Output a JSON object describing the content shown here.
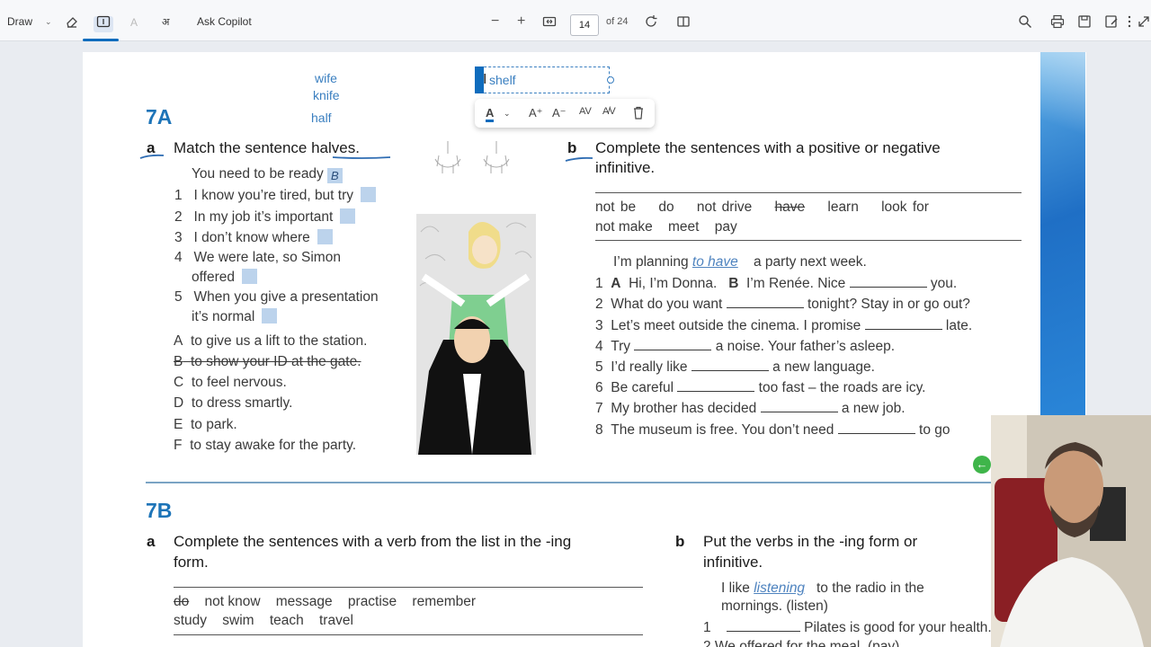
{
  "toolbar": {
    "draw_label": "Draw",
    "ask_copilot_label": "Ask Copilot",
    "page_current": "14",
    "page_total": "of 24",
    "zoom_out": "−",
    "zoom_in": "+"
  },
  "annotation": {
    "text": "shelf",
    "handwritten_words": [
      "wife",
      "knife",
      "half"
    ]
  },
  "section_7a": {
    "title": "7A",
    "a_label": "a",
    "a_instruction": "Match the sentence halves.",
    "example_line": "You need to be ready",
    "example_box": "B",
    "items": [
      {
        "num": "1",
        "text": "I know you’re tired, but try"
      },
      {
        "num": "2",
        "text": "In my job it’s important"
      },
      {
        "num": "3",
        "text": "I don’t know where"
      },
      {
        "num": "4",
        "text": "We were late, so Simon"
      },
      {
        "num": "",
        "text": "offered"
      },
      {
        "num": "5",
        "text": "When you give a presentation"
      },
      {
        "num": "",
        "text": "it’s normal"
      }
    ],
    "options": [
      {
        "letter": "A",
        "text": "to give us a lift to the station."
      },
      {
        "letter": "B",
        "text": "to show your ID at the gate."
      },
      {
        "letter": "C",
        "text": "to feel nervous."
      },
      {
        "letter": "D",
        "text": "to dress smartly."
      },
      {
        "letter": "E",
        "text": "to park."
      },
      {
        "letter": "F",
        "text": "to stay awake for the party."
      }
    ],
    "b_label": "b",
    "b_instruction_line1": "Complete the sentences with a positive or negative",
    "b_instruction_line2": "infinitive.",
    "word_bank_row1": [
      "not be",
      "do",
      "not drive",
      "have",
      "learn",
      "look for"
    ],
    "word_bank_row2": [
      "not make",
      "meet",
      "pay"
    ],
    "example_pre": "I’m planning",
    "example_answer": "to have",
    "example_post": "a party next week.",
    "sentences": [
      {
        "num": "1",
        "pre": "A  Hi, I’m Donna.   B  I’m Renée. Nice",
        "post": "you."
      },
      {
        "num": "2",
        "pre": "What do you want",
        "post": "tonight? Stay in or go out?"
      },
      {
        "num": "3",
        "pre": "Let’s meet outside the cinema. I promise",
        "post": "late."
      },
      {
        "num": "4",
        "pre": "Try",
        "post": "a noise. Your father’s asleep."
      },
      {
        "num": "5",
        "pre": "I’d really like",
        "post": "a new language."
      },
      {
        "num": "6",
        "pre": "Be careful",
        "post": "too fast – the roads are icy."
      },
      {
        "num": "7",
        "pre": "My brother has decided",
        "post": "a new job."
      },
      {
        "num": "8",
        "pre": "The museum is free. You don’t need",
        "post": "to go"
      }
    ]
  },
  "section_7b": {
    "title": "7B",
    "a_label": "a",
    "a_instruction_line1": "Complete the sentences with a verb from the list in the -ing",
    "a_instruction_line2": "form.",
    "word_bank_row1": [
      "do",
      "not know",
      "message",
      "practise",
      "remember"
    ],
    "word_bank_row2": [
      "study",
      "swim",
      "teach",
      "travel"
    ],
    "b_label": "b",
    "b_instruction_line1": "Put the verbs in the -ing form or",
    "b_instruction_line2": "infinitive.",
    "example_pre": "I like",
    "example_answer": "listening",
    "example_post": "to the radio in the",
    "example_line2": "mornings. (listen)",
    "item1_num": "1",
    "item1_post": "Pilates is good for your health.",
    "item2_partial": "2  We offered                for the meal. (pay)"
  }
}
